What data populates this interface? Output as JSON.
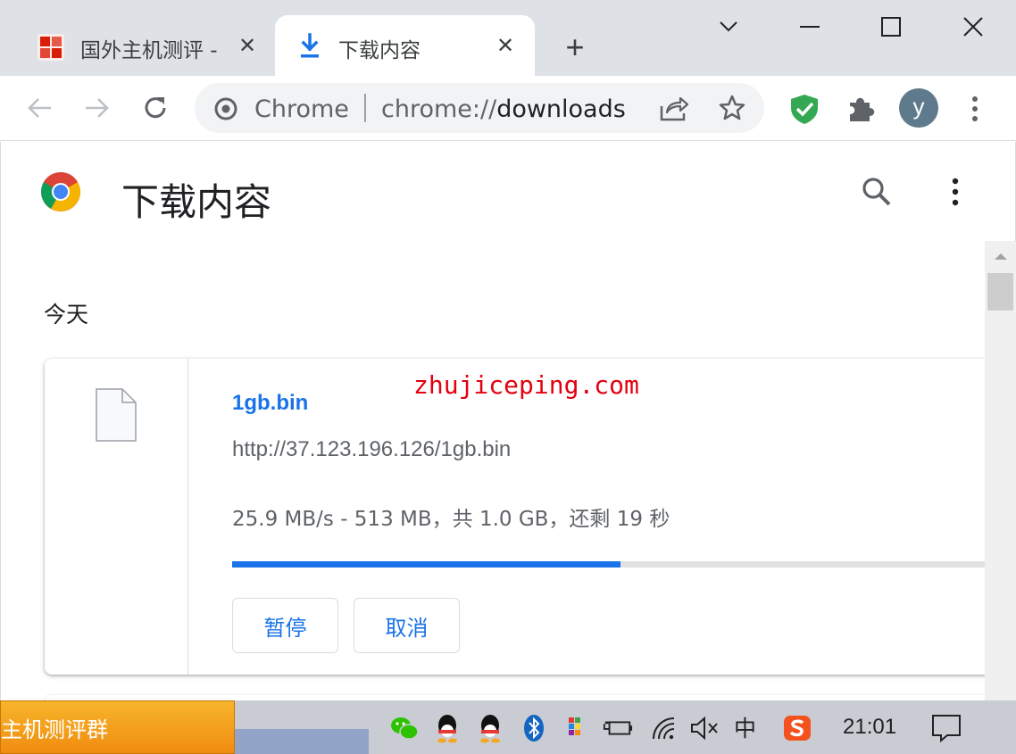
{
  "tabs": [
    {
      "title": "国外主机测评 - ",
      "close": "✕",
      "icon": "site-favicon"
    },
    {
      "title": "下载内容",
      "close": "✕",
      "icon": "download-icon"
    }
  ],
  "new_tab": "+",
  "window_controls": {
    "dropdown": "tab-search-icon",
    "minimize": "minimize-icon",
    "maximize": "maximize-icon",
    "close": "close-icon"
  },
  "omnibox": {
    "scheme_label": "Chrome",
    "url_prefix": "chrome://",
    "url_path": "downloads"
  },
  "profile": {
    "initial": "y"
  },
  "page": {
    "title": "下载内容",
    "date_heading": "今天"
  },
  "download": {
    "file_name": "1gb.bin",
    "url": "http://37.123.196.126/1gb.bin",
    "status": "25.9 MB/s - 513 MB，共 1.0 GB，还剩 19 秒",
    "progress_fraction": 0.5,
    "pause_label": "暂停",
    "cancel_label": "取消"
  },
  "watermark": "zhujiceping.com",
  "taskbar": {
    "app_label": "主机测评群",
    "ime": "中",
    "clock": "21:01"
  },
  "colors": {
    "accent": "#1a73e8",
    "watermark": "#e3000f",
    "taskbar_app": "#f5a623",
    "shield": "#34a853"
  }
}
